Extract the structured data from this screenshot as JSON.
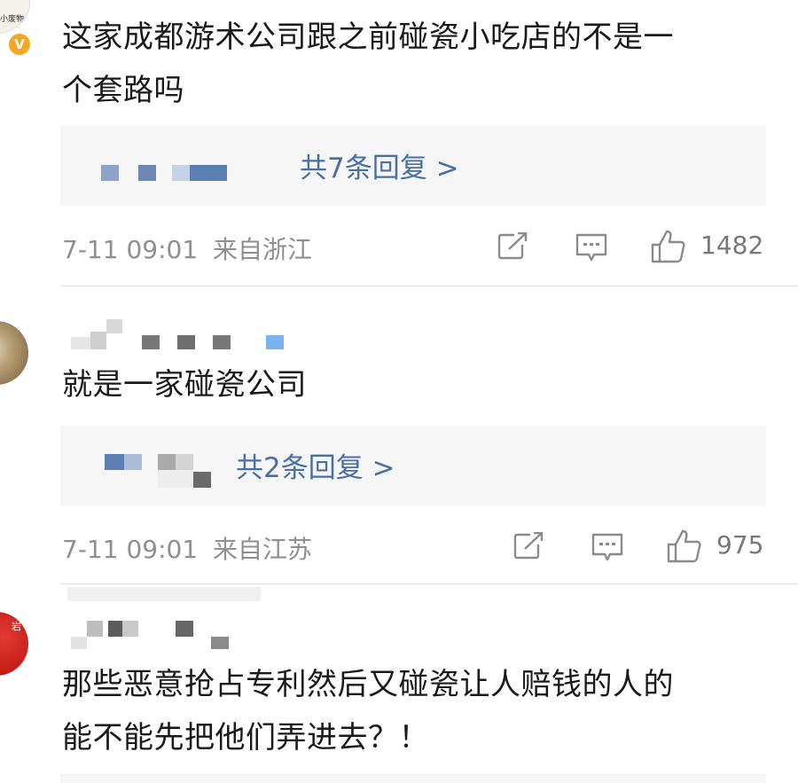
{
  "comments": [
    {
      "avatar_label": "小废物",
      "verified_badge": "V",
      "text_line1": "这家成都游术公司跟之前碰瓷小吃店的不是一",
      "text_line2": "个套路吗",
      "reply_link": "共7条回复 >",
      "timestamp": "7-11 09:01",
      "location": "来自浙江",
      "likes": "1482"
    },
    {
      "text_line1": "就是一家碰瓷公司",
      "reply_link": "共2条回复 >",
      "timestamp": "7-11 09:01",
      "location": "来自江苏",
      "likes": "975"
    },
    {
      "avatar_label": "岩",
      "text_line1": "那些恶意抢占专利然后又碰瓷让人赔钱的人的",
      "text_line2": "能不能先把他们弄进去？！"
    }
  ],
  "icons": {
    "share": "share-icon",
    "comment": "comment-icon",
    "like": "thumbs-up-icon"
  },
  "colors": {
    "reply_link": "#4a6fa5",
    "meta_text": "#8f8f8f",
    "reply_bg": "#f6f6f6",
    "badge": "#f5a623"
  }
}
